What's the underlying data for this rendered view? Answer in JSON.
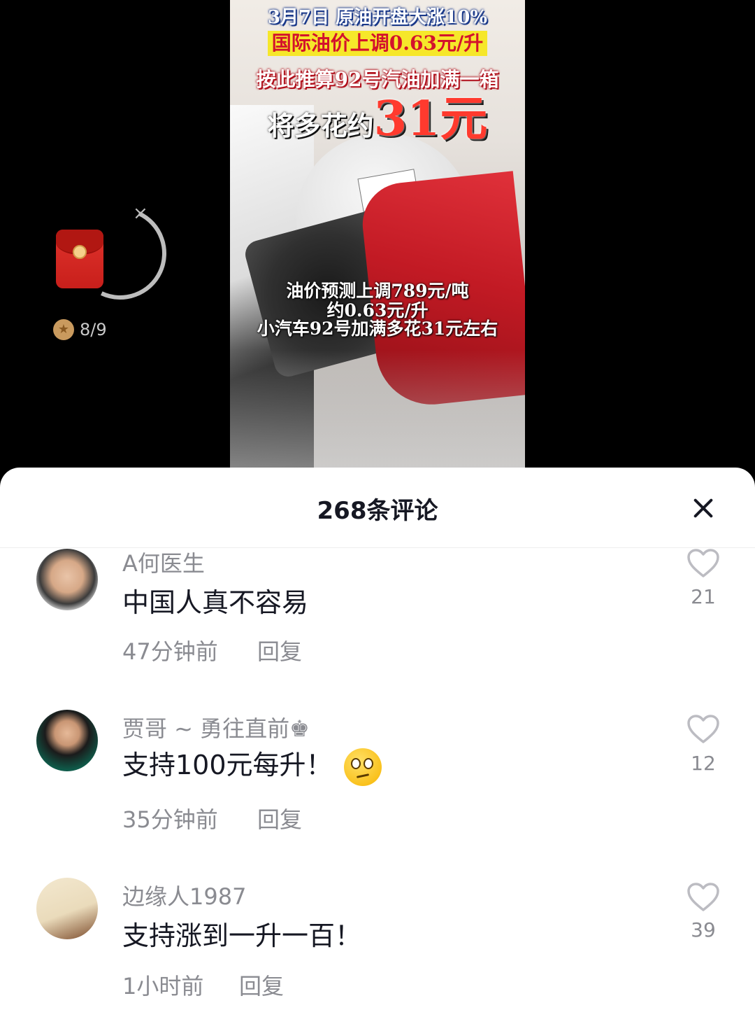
{
  "video": {
    "title_line1": "3月7日 原油开盘大涨10%",
    "title_line2": "国际油价上调0.63元/升",
    "title_line3": "按此推算92号汽油加满一箱",
    "title_line4_prefix": "将多花约",
    "title_line4_amount": "31元",
    "caption_line1": "油价预测上调789元/吨",
    "caption_line2": "约0.63元/升",
    "caption_line3": "小汽车92号加满多花31元左右"
  },
  "red_packet": {
    "progress": "8/9",
    "close_symbol": "×"
  },
  "comments_panel": {
    "title": "268条评论",
    "reply_label": "回复",
    "comments": [
      {
        "username": "A何医生",
        "text": "中国人真不容易",
        "time": "47分钟前",
        "likes": "21"
      },
      {
        "username": "贾哥 ~ 勇往直前♚",
        "text": "支持100元每升！",
        "emoji": "eye-roll-emoji",
        "time": "35分钟前",
        "likes": "12"
      },
      {
        "username": "边缘人1987",
        "text": "支持涨到一升一百！",
        "time": "1小时前",
        "likes": "39"
      }
    ]
  }
}
